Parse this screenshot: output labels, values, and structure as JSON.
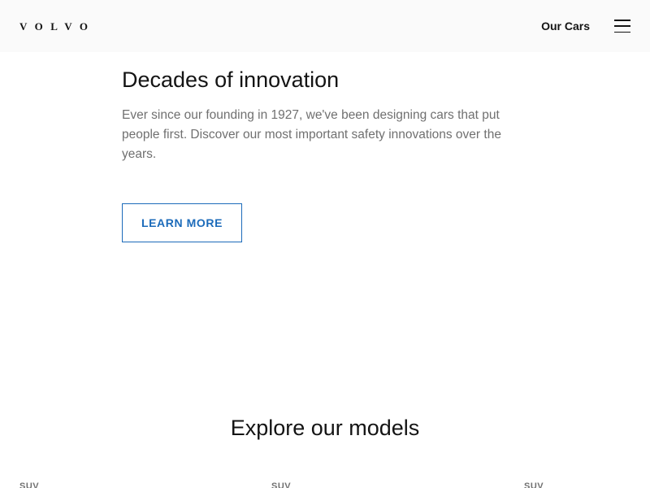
{
  "header": {
    "logo": "VOLVO",
    "nav_link": "Our Cars",
    "menu_icon": "hamburger-menu-icon"
  },
  "innovation": {
    "title": "Decades of innovation",
    "body": "Ever since our founding in 1927, we've been designing cars that put people first. Discover our most important safety innovations over the years.",
    "button_label": "LEARN MORE"
  },
  "explore": {
    "title": "Explore our models",
    "categories": [
      "SUV",
      "SUV",
      "SUV"
    ]
  },
  "colors": {
    "accent": "#1c6bba",
    "header_bg": "#fafafa",
    "text": "#141414",
    "muted_text": "#707070"
  }
}
